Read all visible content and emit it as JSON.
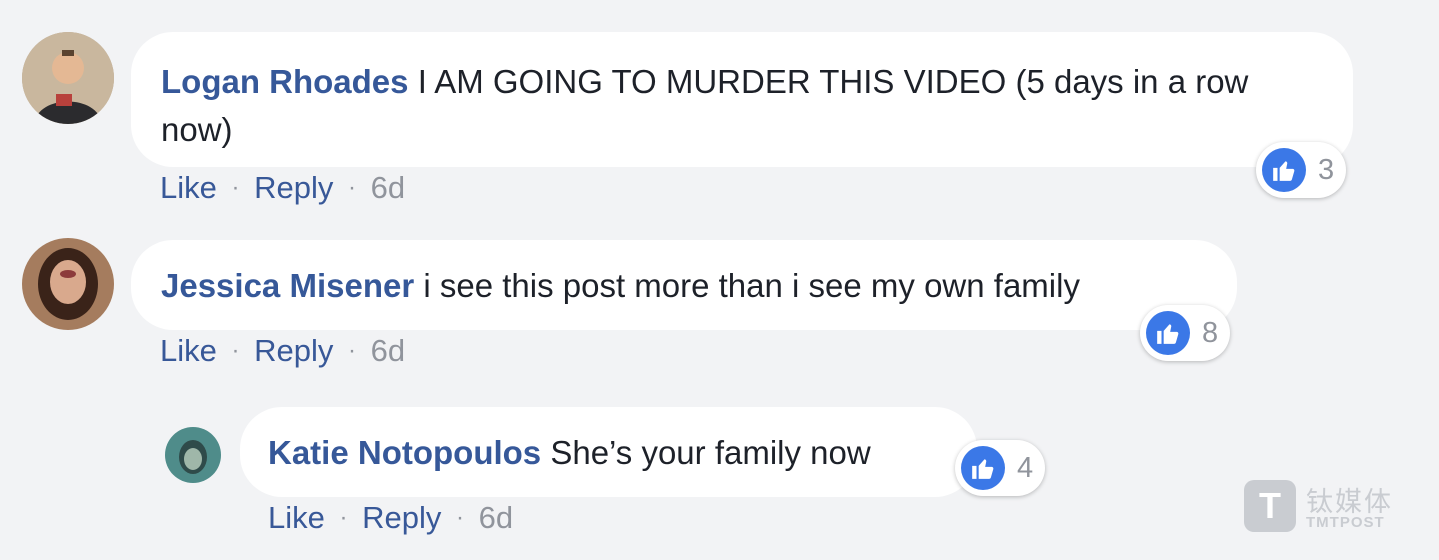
{
  "comments": [
    {
      "author": "Logan Rhoades",
      "text": "I AM GOING TO MURDER THIS VIDEO (5 days in a row now)",
      "like_label": "Like",
      "reply_label": "Reply",
      "separator": "·",
      "time": "6d",
      "reaction_count": "3"
    },
    {
      "author": "Jessica Misener",
      "text": "i see this post more than i see my own family",
      "like_label": "Like",
      "reply_label": "Reply",
      "separator": "·",
      "time": "6d",
      "reaction_count": "8"
    },
    {
      "author": "Katie Notopoulos",
      "text": "She’s your family now",
      "like_label": "Like",
      "reply_label": "Reply",
      "separator": "·",
      "time": "6d",
      "reaction_count": "4"
    }
  ],
  "watermark": {
    "logo_letter": "T",
    "chinese_text": "钛媒体",
    "english_text": "TMTPOST"
  },
  "colors": {
    "background": "#f2f3f5",
    "bubble": "#ffffff",
    "author_name": "#365899",
    "like_blue": "#3b78e7",
    "meta_gray": "#90949c"
  }
}
